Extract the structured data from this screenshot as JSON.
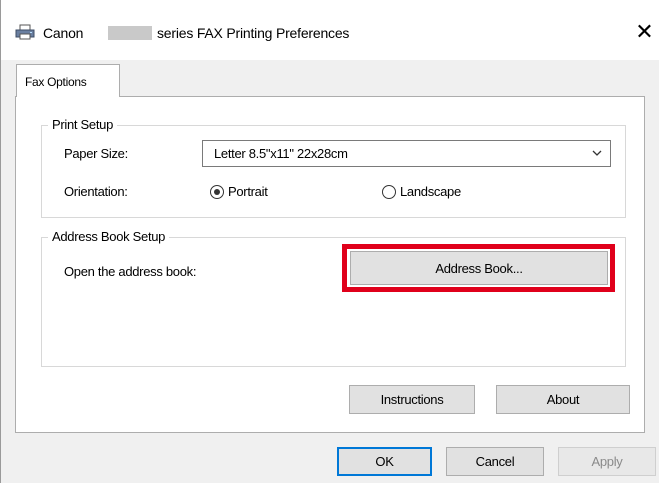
{
  "window": {
    "title_prefix": "Canon",
    "title_suffix": "series FAX Printing Preferences",
    "close_glyph": "✕"
  },
  "tabs": [
    {
      "label": "Fax Options",
      "active": true
    }
  ],
  "print_setup": {
    "legend": "Print Setup",
    "paper_size_label": "Paper Size:",
    "paper_size_value": "Letter 8.5\"x11\" 22x28cm",
    "orientation_label": "Orientation:",
    "orientation_options": [
      "Portrait",
      "Landscape"
    ],
    "orientation_selected": "Portrait"
  },
  "address_book_setup": {
    "legend": "Address Book Setup",
    "open_label": "Open the address book:",
    "button_label": "Address Book..."
  },
  "panel_buttons": {
    "instructions": "Instructions",
    "about": "About"
  },
  "dialog_buttons": {
    "ok": "OK",
    "cancel": "Cancel",
    "apply": "Apply"
  },
  "colors": {
    "highlight": "#e0001b",
    "default_button_border": "#0078d7"
  },
  "icons": {
    "title": "printer-icon",
    "combo": "chevron-down-icon",
    "close": "close-icon"
  }
}
